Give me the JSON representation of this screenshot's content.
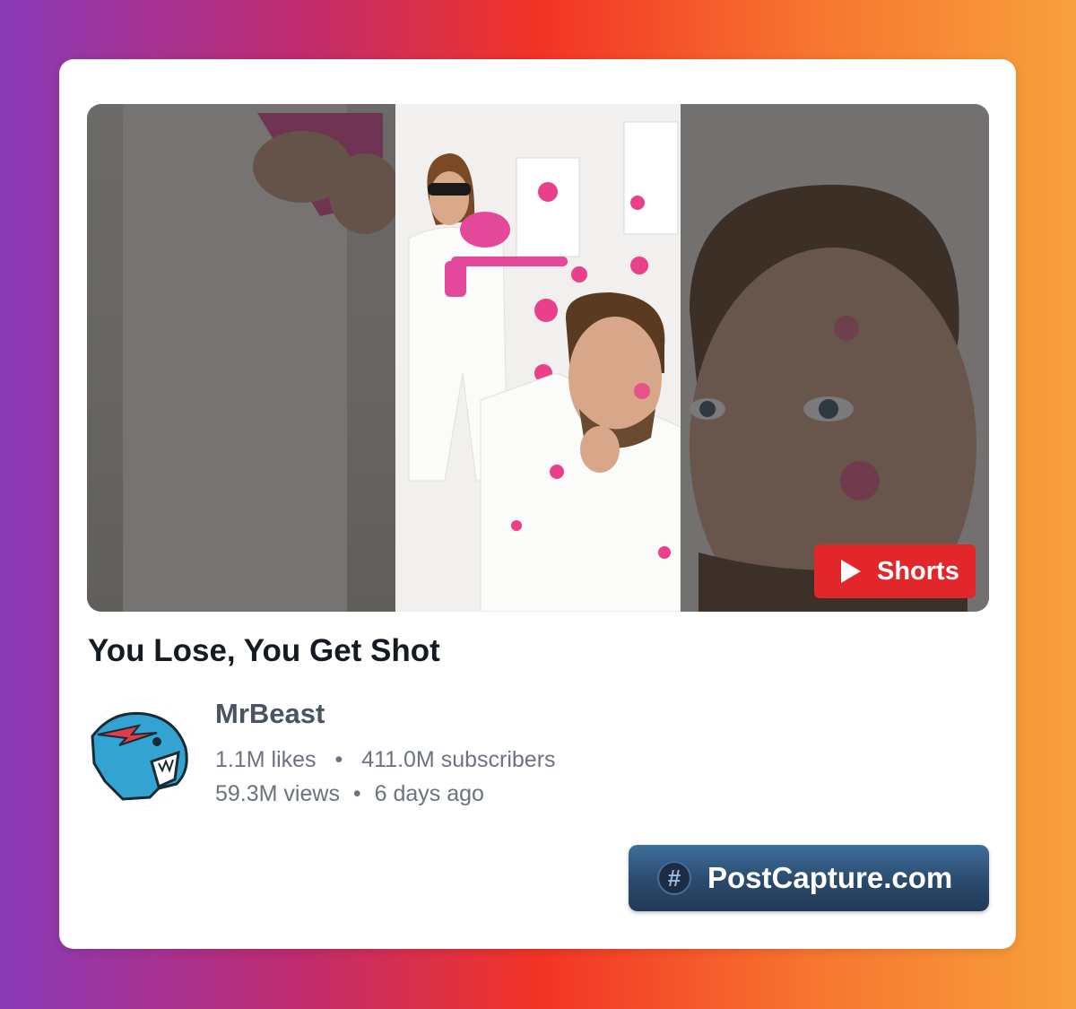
{
  "video": {
    "title": "You Lose, You Get Shot",
    "badge_label": "Shorts"
  },
  "channel": {
    "name": "MrBeast",
    "likes": "1.1M likes",
    "subscribers": "411.0M subscribers",
    "views": "59.3M views",
    "posted": "6 days ago",
    "separator": "•"
  },
  "footer": {
    "button_label": "PostCapture.com",
    "button_icon": "hash-icon"
  },
  "colors": {
    "badge": "#e3262a",
    "title_text": "#151a23",
    "meta_text": "#6b7280",
    "button": "#2a4a6d"
  }
}
